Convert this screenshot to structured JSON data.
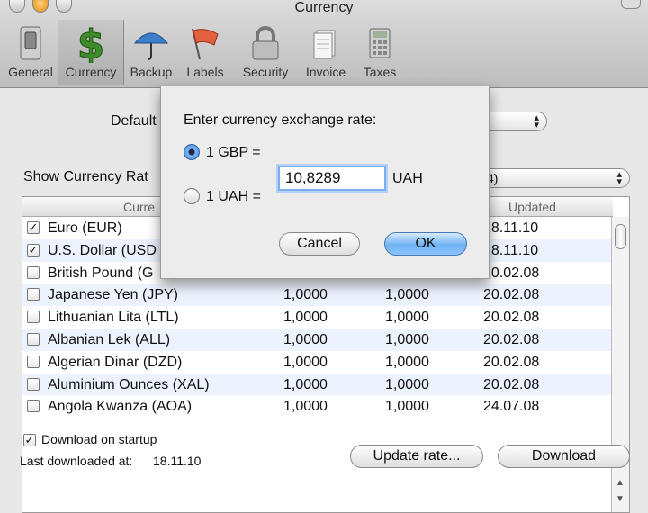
{
  "window": {
    "title": "Currency"
  },
  "toolbar": {
    "items": [
      {
        "label": "General"
      },
      {
        "label": "Currency"
      },
      {
        "label": "Backup"
      },
      {
        "label": "Labels"
      },
      {
        "label": "Security"
      },
      {
        "label": "Invoice"
      },
      {
        "label": "Taxes"
      }
    ]
  },
  "prefs": {
    "default_label": "Default",
    "show_rates_label": "Show Currency Rat",
    "show_rates_value": "4)"
  },
  "table": {
    "headers": {
      "currency": "Curre",
      "updated": "Updated"
    },
    "rows": [
      {
        "checked": "✓",
        "name": "Euro (EUR)",
        "rate1": "",
        "rate2": "",
        "updated": "18.11.10"
      },
      {
        "checked": "✓",
        "name": "U.S. Dollar (USD",
        "rate1": "",
        "rate2": "",
        "updated": "18.11.10"
      },
      {
        "checked": "",
        "name": "British Pound (G",
        "rate1": "",
        "rate2": "",
        "updated": "20.02.08"
      },
      {
        "checked": "",
        "name": "Japanese Yen (JPY)",
        "rate1": "1,0000",
        "rate2": "1,0000",
        "updated": "20.02.08"
      },
      {
        "checked": "",
        "name": "Lithuanian Lita (LTL)",
        "rate1": "1,0000",
        "rate2": "1,0000",
        "updated": "20.02.08"
      },
      {
        "checked": "",
        "name": "Albanian Lek (ALL)",
        "rate1": "1,0000",
        "rate2": "1,0000",
        "updated": "20.02.08"
      },
      {
        "checked": "",
        "name": "Algerian Dinar (DZD)",
        "rate1": "1,0000",
        "rate2": "1,0000",
        "updated": "20.02.08"
      },
      {
        "checked": "",
        "name": "Aluminium Ounces (XAL)",
        "rate1": "1,0000",
        "rate2": "1,0000",
        "updated": "20.02.08"
      },
      {
        "checked": "",
        "name": "Angola Kwanza (AOA)",
        "rate1": "1,0000",
        "rate2": "1,0000",
        "updated": "24.07.08"
      }
    ]
  },
  "bottom": {
    "download_startup_checked": "✓",
    "download_startup_label": "Download on startup",
    "last_downloaded_label": "Last downloaded at:",
    "last_downloaded_value": "18.11.10",
    "update_rate_label": "Update rate...",
    "download_label": "Download"
  },
  "dialog": {
    "prompt": "Enter currency exchange rate:",
    "option1": "1 GBP =",
    "option2": "1 UAH =",
    "rate_value": "10,8289",
    "unit": "UAH",
    "cancel_label": "Cancel",
    "ok_label": "OK"
  },
  "colors": {
    "accent": "#6fb2f2",
    "row_alt": "#edf3fe"
  }
}
